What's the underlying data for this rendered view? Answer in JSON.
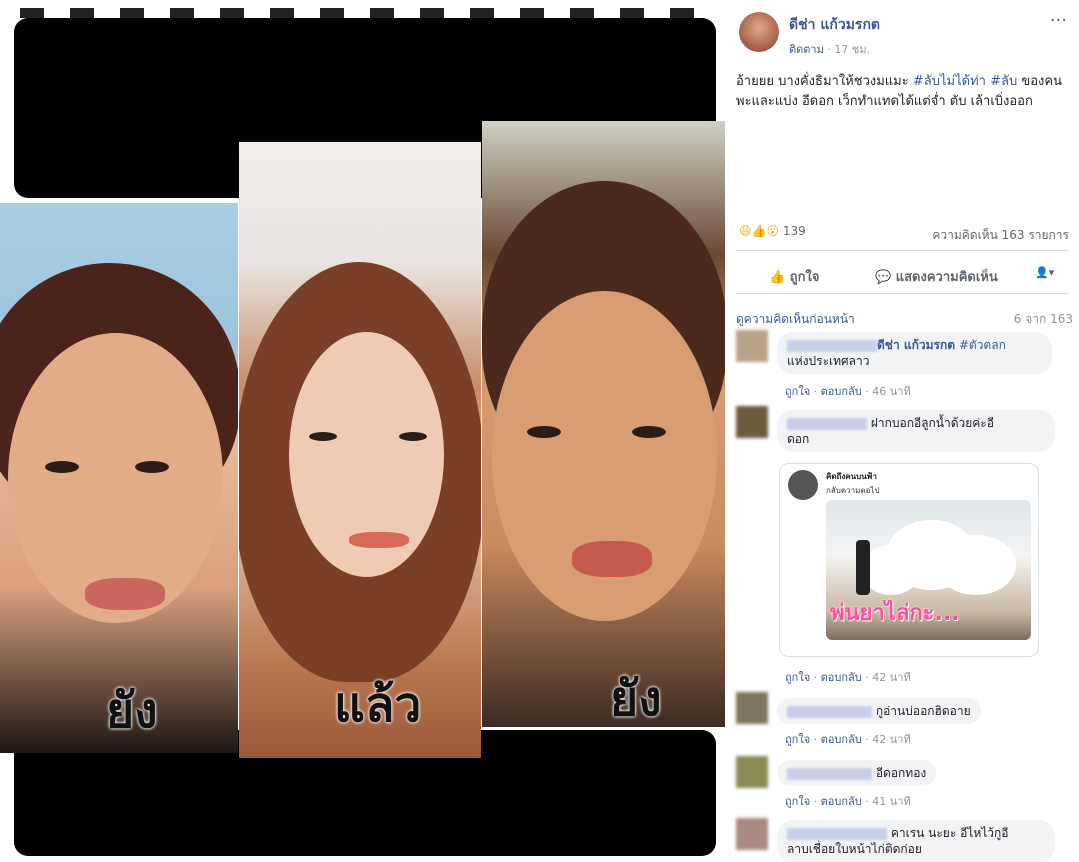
{
  "collage": {
    "captions": [
      "ยัง",
      "แล้ว",
      "ยัง"
    ]
  },
  "post": {
    "author": "ดีช่า แก้วมรกต",
    "follow": "ติดตาม",
    "time": "17 ชม.",
    "more_icon": "ellipsis-icon",
    "text": "อ้ายยย บางคั่งธิมาให้ชวงมแมะ",
    "hashtag1": "#ลับไม่ได้ท่า",
    "hashtag2": "#ลับ",
    "text2": "ของคนพะและแบ่ง อีดอก เว็กทำแทดได้แต่จ่ำ ตับ เล้าเบิ่งออก",
    "reaction_count": "139",
    "comment_count": "ความคิดเห็น 163 รายการ",
    "like_label": "ถูกใจ",
    "comment_label": "แสดงความคิดเห็น"
  },
  "comments_header": {
    "view_previous": "ดูความคิดเห็นก่อนหน้า",
    "count": "6 จาก 163"
  },
  "comments": [
    {
      "mention": "ดีช่า แก้วมรกต",
      "hashtag": "#ตัวตลก",
      "text": "แห่งประเทศลาว",
      "like": "ถูกใจ",
      "reply": "ตอบกลับ",
      "time": "46 นาที"
    },
    {
      "text": "ฝากบอกอีลูกน้ำด้วยค่ะอี",
      "text2": "ดอก",
      "like": "ถูกใจ",
      "reply": "ตอบกลับ",
      "time": "42 นาที"
    },
    {
      "text": "กูอ่านบ่ออกฮิดอาย",
      "like": "ถูกใจ",
      "reply": "ตอบกลับ",
      "time": "42 นาที"
    },
    {
      "text": "อีดอกทอง",
      "like": "ถูกใจ",
      "reply": "ตอบกลับ",
      "time": "41 นาที"
    },
    {
      "text": "คาเรน นะยะ อีไหไว้กูอี",
      "text2": "ลาบเชื่อยใบหน้าไก่ติดก่อย"
    }
  ],
  "shared_post": {
    "author": "คิดถึงคนบนฟ้า",
    "subtitle": "กลับความตอไป",
    "overlay": "พ่นยาไล่กะ..."
  }
}
